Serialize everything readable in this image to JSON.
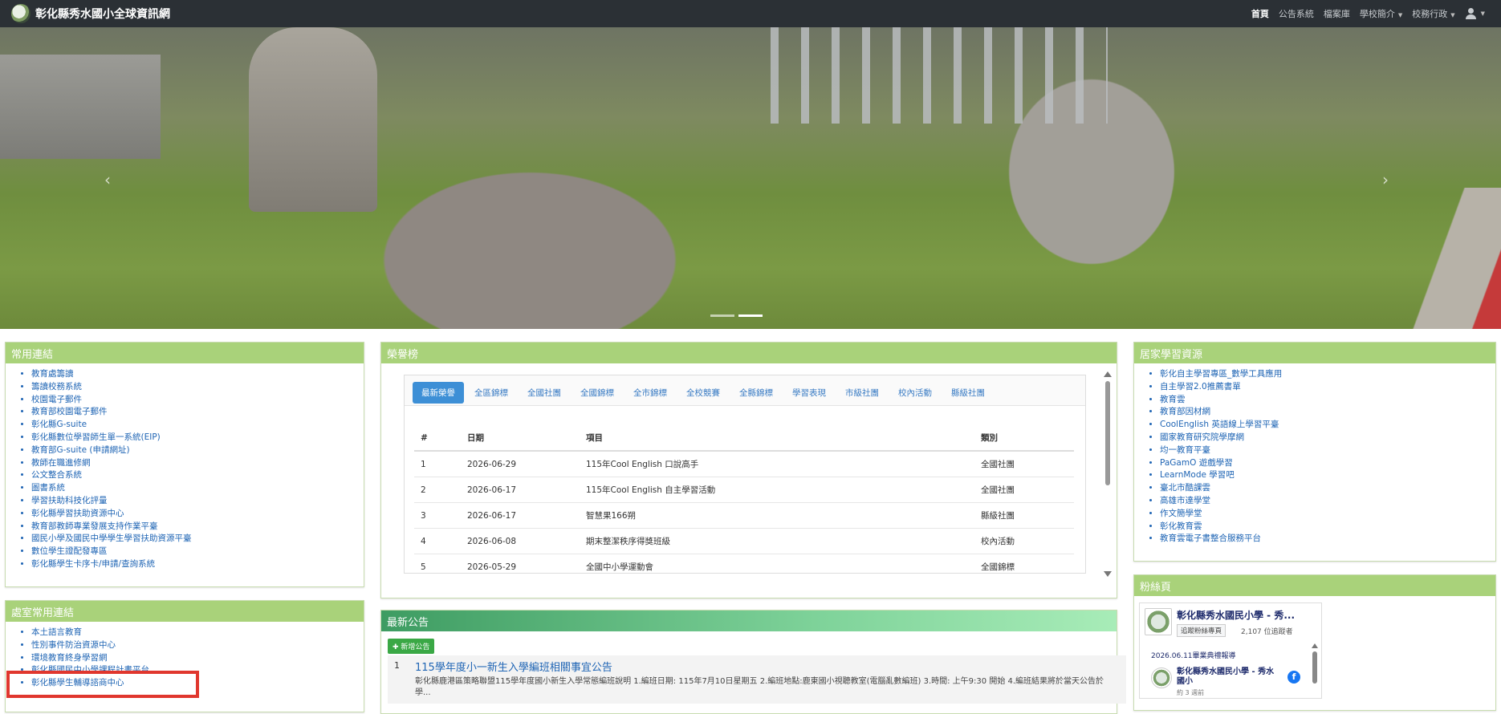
{
  "navbar": {
    "title": "彰化縣秀水國小全球資訊網",
    "links": [
      {
        "label": "首頁",
        "active": true,
        "dropdown": false
      },
      {
        "label": "公告系統",
        "active": false,
        "dropdown": false
      },
      {
        "label": "檔案庫",
        "active": false,
        "dropdown": false
      },
      {
        "label": "學校簡介",
        "active": false,
        "dropdown": true
      },
      {
        "label": "校務行政",
        "active": false,
        "dropdown": true
      }
    ],
    "user_icon": "user-icon"
  },
  "banner": {
    "prev_icon": "‹",
    "next_icon": "›"
  },
  "common_links": {
    "title": "常用連結",
    "items": [
      "教育處籌讀",
      "籌讀校務系統",
      "校園電子郵件",
      "教育部校園電子郵件",
      "彰化縣G-suite",
      "彰化縣數位學習師生單一系統(EIP)",
      "教育部G-suite (申請網址)",
      "教師在職進修網",
      "公文整合系統",
      "圖書系統",
      "學習扶助科技化評量",
      "彰化縣學習扶助資源中心",
      "教育部教師專業發展支持作業平臺",
      "國民小學及國民中學學生學習扶助資源平臺",
      "數位學生證配發專區",
      "彰化縣學生卡序卡/申請/查詢系統"
    ]
  },
  "office_links": {
    "title": "處室常用連結",
    "items": [
      "本土語言教育",
      "性別事件防治資源中心",
      "環境教育終身學習網",
      "彰化縣國民中小學課程計畫平台",
      "彰化縣學生輔導諮商中心"
    ]
  },
  "honor": {
    "title": "榮譽榜",
    "tabs": [
      "最新榮譽",
      "全區錦標",
      "全國社團",
      "全國錦標",
      "全市錦標",
      "全校競賽",
      "全縣錦標",
      "學習表現",
      "市級社團",
      "校內活動",
      "縣級社團"
    ],
    "columns": [
      "#",
      "日期",
      "項目",
      "類別"
    ],
    "rows": [
      [
        "1",
        "2026-06-29",
        "115年Cool English 口說高手",
        "全國社團"
      ],
      [
        "2",
        "2026-06-17",
        "115年Cool English 自主學習活動",
        "全國社團"
      ],
      [
        "3",
        "2026-06-17",
        "智慧果166朔",
        "縣級社團"
      ],
      [
        "4",
        "2026-06-08",
        "期末整潔秩序得獎班級",
        "校內活動"
      ],
      [
        "5",
        "2026-05-29",
        "全國中小學運動會",
        "全國錦標"
      ]
    ]
  },
  "announcements": {
    "title": "最新公告",
    "add_button": "✚ 新增公告",
    "items": [
      {
        "num": "1",
        "title": "115學年度小一新生入學編班相關事宜公告",
        "body": "彰化縣鹿港區策略聯盟115學年度國小新生入學常態編班說明 1.編班日期: 115年7月10日星期五 2.編班地點:鹿東國小視聽教室(電腦亂數編班) 3.時間: 上午9:30 開始 4.編班結果將於當天公告於學..."
      }
    ]
  },
  "home_learning": {
    "title": "居家學習資源",
    "items": [
      "彰化自主學習專區_數學工具應用",
      "自主學習2.0推薦書單",
      "教育雲",
      "教育部因材網",
      "CoolEnglish 英語線上學習平臺",
      "國家教育研究院學摩網",
      "均一教育平臺",
      "PaGamO 遊戲學習",
      "LearnMode 學習吧",
      "臺北市酷課雲",
      "高雄市達學堂",
      "作文簡學堂",
      "彰化教育雲",
      "教育雲電子書整合服務平台"
    ]
  },
  "fan_page": {
    "title": "粉絲頁",
    "page_name": "彰化縣秀水國民小學 - 秀...",
    "follow_label": "追蹤粉絲專頁",
    "followers": "2,107 位追蹤者",
    "post_date": "2026.06.11畢業典禮報導",
    "post_author": "彰化縣秀水國民小學 - 秀水國小",
    "post_time": "約 3 週前",
    "fb_logo": "f"
  },
  "colors": {
    "navbar_bg": "#2b3035",
    "panel_header": "#a9d27a",
    "link": "#1e64b4",
    "active_tab": "#3d8fd6",
    "add_button": "#3aa845",
    "highlight": "#e0372e"
  }
}
